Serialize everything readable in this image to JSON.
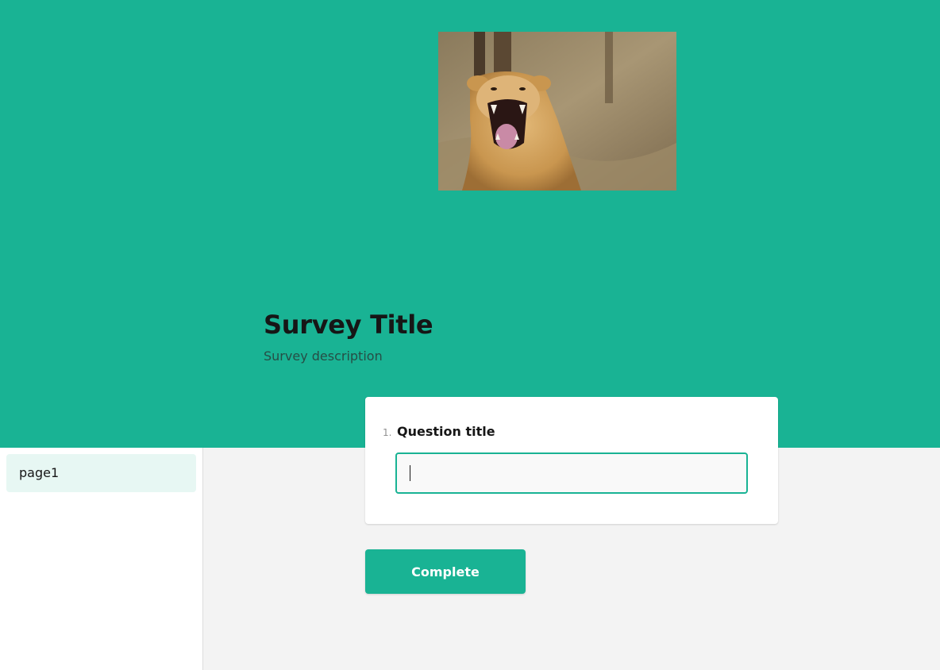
{
  "colors": {
    "accent": "#19b394",
    "background": "#f3f3f3",
    "card": "#ffffff",
    "page_item_selected": "#e7f7f3"
  },
  "header": {
    "logo_icon": "lion-photo",
    "title": "Survey Title",
    "description": "Survey description"
  },
  "sidebar": {
    "pages": [
      {
        "label": "page1",
        "selected": true
      }
    ]
  },
  "question": {
    "number": "1.",
    "title": "Question title",
    "value": ""
  },
  "navigation": {
    "complete_label": "Complete"
  }
}
